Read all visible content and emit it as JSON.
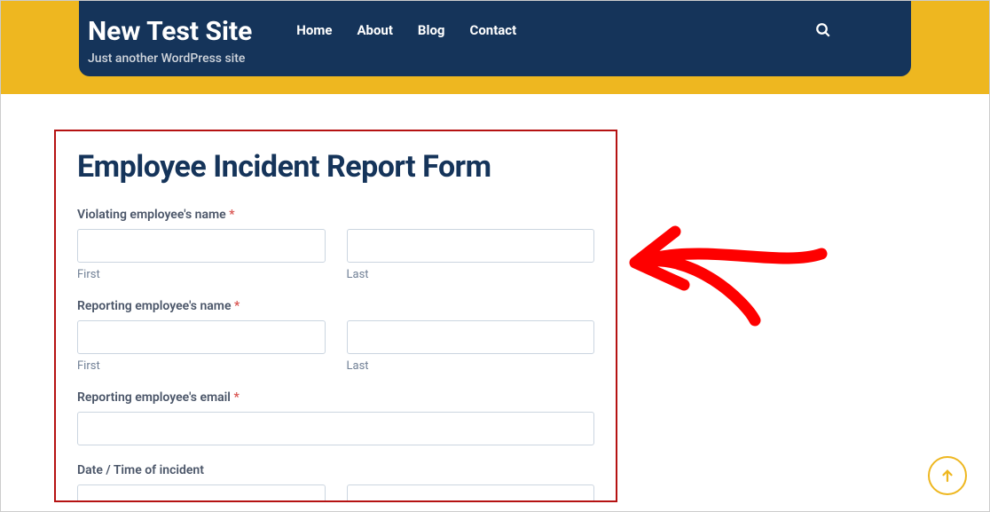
{
  "header": {
    "site_title": "New Test Site",
    "tagline": "Just another WordPress site",
    "nav": {
      "home": "Home",
      "about": "About",
      "blog": "Blog",
      "contact": "Contact"
    }
  },
  "form": {
    "title": "Employee Incident Report Form",
    "violating_name_label": "Violating employee's name",
    "reporting_name_label": "Reporting employee's name",
    "reporting_email_label": "Reporting employee's email",
    "datetime_label": "Date / Time of incident",
    "required_marker": "*",
    "sublabel_first": "First",
    "sublabel_last": "Last"
  },
  "colors": {
    "navbar": "#15345a",
    "accent": "#eeb720",
    "form_border": "#b51212",
    "required": "#d9534f"
  }
}
